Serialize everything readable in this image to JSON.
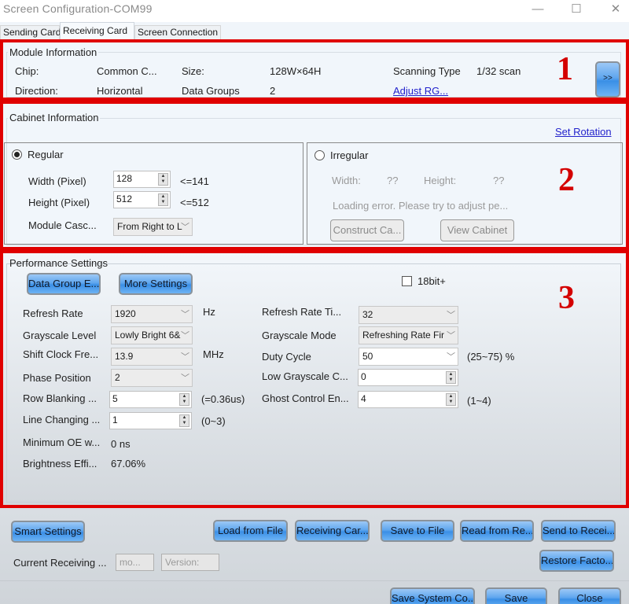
{
  "window": {
    "title": "Screen Configuration-COM99",
    "controls": {
      "minimize": "—",
      "maximize": "☐",
      "close": "✕"
    }
  },
  "tabs": [
    {
      "label": "Sending Card",
      "active": false
    },
    {
      "label": "Receiving Card",
      "active": true
    },
    {
      "label": "Screen Connection",
      "active": false
    }
  ],
  "annotations": {
    "box1": "1",
    "box2": "2",
    "box3": "3",
    "color": "#e00000"
  },
  "module_info": {
    "title": "Module Information",
    "chip_label": "Chip:",
    "chip_value": "Common C...",
    "size_label": "Size:",
    "size_value": "128W×64H",
    "scanning_label": "Scanning Type",
    "scanning_value": "1/32 scan",
    "direction_label": "Direction:",
    "direction_value": "Horizontal",
    "data_groups_label": "Data Groups",
    "data_groups_value": "2",
    "adjust_link": "Adjust RG...",
    "expand_button": ">>"
  },
  "cabinet_info": {
    "title": "Cabinet Information",
    "set_rotation_link": "Set Rotation",
    "regular": {
      "label": "Regular",
      "selected": true,
      "width_label": "Width (Pixel)",
      "width_value": "128",
      "width_limit": "<=141",
      "height_label": "Height (Pixel)",
      "height_value": "512",
      "height_limit": "<=512",
      "cascade_label": "Module Casc...",
      "cascade_value": "From Right to L"
    },
    "irregular": {
      "label": "Irregular",
      "selected": false,
      "width_label": "Width:",
      "width_value": "??",
      "height_label": "Height:",
      "height_value": "??",
      "error_text": "Loading error. Please try to adjust pe...",
      "construct_button": "Construct Ca...",
      "view_button": "View Cabinet"
    }
  },
  "performance": {
    "title": "Performance Settings",
    "data_group_button": "Data Group E...",
    "more_settings_button": "More Settings",
    "bit18_label": "18bit+",
    "bit18_checked": false,
    "refresh_rate_label": "Refresh Rate",
    "refresh_rate_value": "1920",
    "refresh_rate_unit": "Hz",
    "grayscale_level_label": "Grayscale Level",
    "grayscale_level_value": "Lowly Bright 6&",
    "shift_clock_label": "Shift Clock Fre...",
    "shift_clock_value": "13.9",
    "shift_clock_unit": "MHz",
    "phase_label": "Phase Position",
    "phase_value": "2",
    "row_blanking_label": "Row Blanking ...",
    "row_blanking_value": "5",
    "row_blanking_note": "(=0.36us)",
    "line_changing_label": "Line Changing ...",
    "line_changing_value": "1",
    "line_changing_note": "(0~3)",
    "min_oe_label": "Minimum OE w...",
    "min_oe_value": "0 ns",
    "brightness_label": "Brightness Effi...",
    "brightness_value": "67.06%",
    "refresh_times_label": "Refresh Rate Ti...",
    "refresh_times_value": "32",
    "grayscale_mode_label": "Grayscale Mode",
    "grayscale_mode_value": "Refreshing Rate Fir",
    "duty_cycle_label": "Duty Cycle",
    "duty_cycle_value": "50",
    "duty_cycle_note": "(25~75) %",
    "low_grayscale_label": "Low Grayscale C...",
    "low_grayscale_value": "0",
    "ghost_label": "Ghost Control En...",
    "ghost_value": "4",
    "ghost_note": "(1~4)"
  },
  "footer": {
    "smart_settings": "Smart Settings",
    "load_from_file": "Load from File",
    "receiving_card": "Receiving Car...",
    "save_to_file": "Save to File",
    "read_from": "Read from Re...",
    "send_to": "Send to Recei...",
    "restore_factory": "Restore Facto...",
    "current_receiving_label": "Current Receiving ...",
    "model_placeholder": "mo...",
    "version_placeholder": "Version:",
    "save_system": "Save System Co...",
    "save": "Save",
    "close": "Close"
  }
}
